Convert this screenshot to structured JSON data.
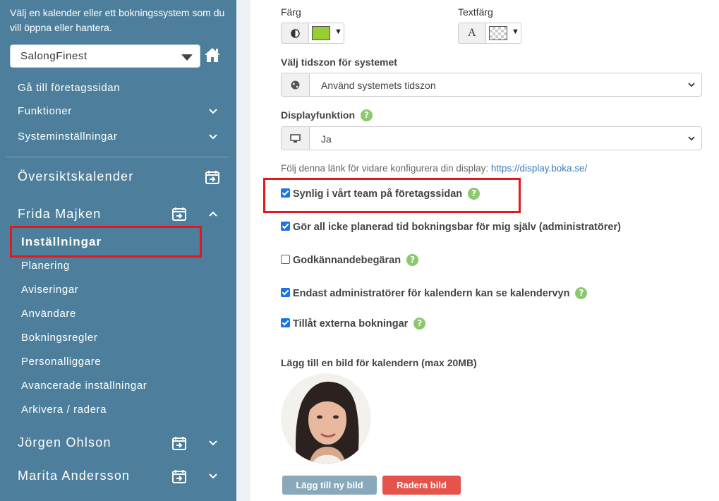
{
  "sidebar": {
    "intro": "Välj en kalender eller ett bokningssystem som du vill öppna eller hantera.",
    "system_select": "SalongFinest",
    "links": [
      "Gå till företagssidan",
      "Funktioner",
      "Systeminställningar"
    ],
    "overview_calendar": "Översiktskalender",
    "calendars": [
      {
        "name": "Frida Majken"
      },
      {
        "name": "Jörgen Ohlson"
      },
      {
        "name": "Marita Andersson"
      }
    ],
    "active_item": "Inställningar",
    "sub_items": [
      "Planering",
      "Aviseringar",
      "Användare",
      "Bokningsregler",
      "Personalliggare",
      "Avancerade inställningar",
      "Arkivera / radera"
    ]
  },
  "main": {
    "color_label": "Färg",
    "text_color_label": "Textfärg",
    "color_value": "#9acd32",
    "timezone_label": "Välj tidszon för systemet",
    "timezone_value": "Använd systemets tidszon",
    "display_label": "Displayfunktion",
    "display_value": "Ja",
    "display_link_text": "Följ denna länk för vidare konfigurera din display: ",
    "display_link": "https://display.boka.se/",
    "checkboxes": [
      {
        "label": "Synlig i vårt team på företagssidan",
        "checked": true,
        "help": true
      },
      {
        "label": "Gör all icke planerad tid bokningsbar för mig själv (administratörer)",
        "checked": true,
        "help": false
      },
      {
        "label": "Godkännandebegäran",
        "checked": false,
        "help": true
      },
      {
        "label": "Endast administratörer för kalendern kan se kalendervyn",
        "checked": true,
        "help": true
      },
      {
        "label": "Tillåt externa bokningar",
        "checked": true,
        "help": true
      }
    ],
    "image_label": "Lägg till en bild för kalendern (max 20MB)",
    "add_image_button": "Lägg till ny bild",
    "delete_image_button": "Radera bild"
  },
  "colors": {
    "sidebar": "#4d7f9c",
    "highlight": "#e3171e",
    "help": "#8cc86e",
    "add_btn": "#89a9bb",
    "delete_btn": "#e5534b"
  }
}
